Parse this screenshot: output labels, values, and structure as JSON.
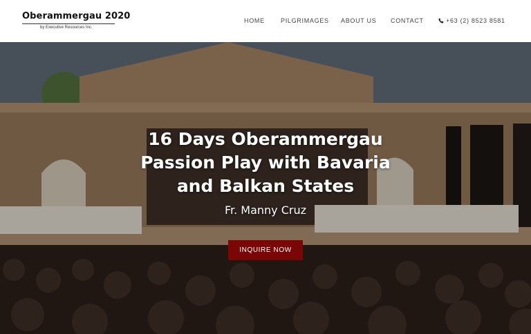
{
  "brand": {
    "title": "Oberammergau 2020",
    "subtitle": "by Executive Resources Inc."
  },
  "nav": {
    "items": [
      "HOME",
      "PILGRIMAGES",
      "ABOUT US",
      "CONTACT"
    ],
    "phone": "+63 (2) 8523 8581",
    "phone_icon": "phone-icon"
  },
  "hero": {
    "title_lines": [
      "16 Days Oberammergau",
      "Passion Play with Bavaria",
      "and Balkan States"
    ],
    "subtitle": "Fr. Manny Cruz",
    "cta_label": "INQUIRE NOW",
    "cta_color": "#7a0606"
  }
}
